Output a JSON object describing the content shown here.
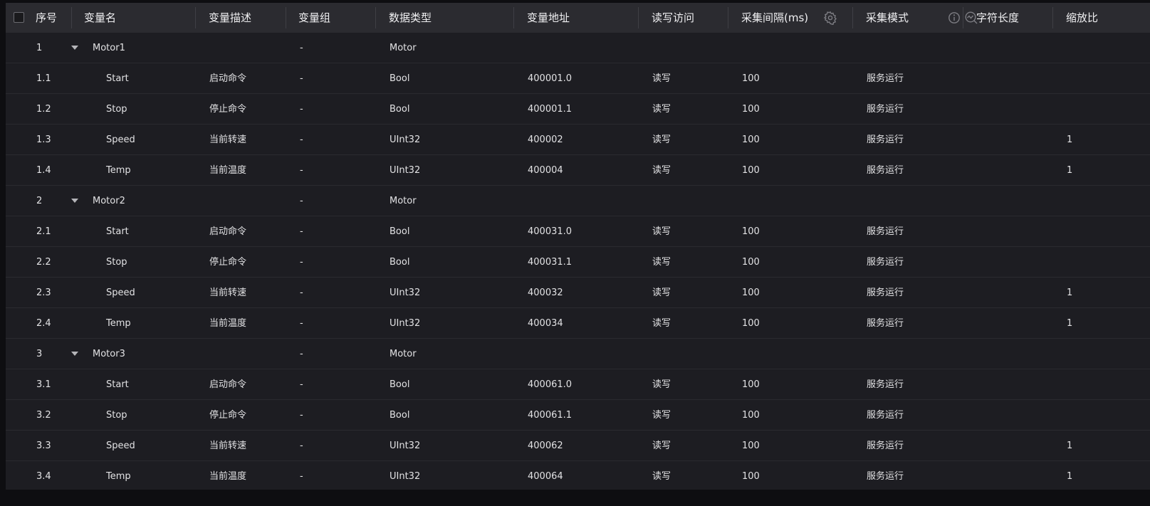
{
  "columns": [
    {
      "key": "index",
      "label": "序号"
    },
    {
      "key": "name",
      "label": "变量名"
    },
    {
      "key": "desc",
      "label": "变量描述"
    },
    {
      "key": "group",
      "label": "变量组"
    },
    {
      "key": "type",
      "label": "数据类型"
    },
    {
      "key": "addr",
      "label": "变量地址"
    },
    {
      "key": "access",
      "label": "读写访问"
    },
    {
      "key": "interval",
      "label": "采集间隔(ms)"
    },
    {
      "key": "mode",
      "label": "采集模式"
    },
    {
      "key": "strlen",
      "label": "字符长度"
    },
    {
      "key": "scale",
      "label": "缩放比"
    }
  ],
  "header_icons": {
    "interval_settings": "gear-icon",
    "mode_info": "info-icon",
    "mode_trend": "trend-search-icon"
  },
  "rows": [
    {
      "index": "1",
      "name": "Motor1",
      "desc": "",
      "group": "-",
      "type": "Motor",
      "addr": "",
      "access": "",
      "interval": "",
      "mode": "",
      "strlen": "",
      "scale": "",
      "parent": true
    },
    {
      "index": "1.1",
      "name": "Start",
      "desc": "启动命令",
      "group": "-",
      "type": "Bool",
      "addr": "400001.0",
      "access": "读写",
      "interval": "100",
      "mode": "服务运行",
      "strlen": "",
      "scale": ""
    },
    {
      "index": "1.2",
      "name": "Stop",
      "desc": "停止命令",
      "group": "-",
      "type": "Bool",
      "addr": "400001.1",
      "access": "读写",
      "interval": "100",
      "mode": "服务运行",
      "strlen": "",
      "scale": ""
    },
    {
      "index": "1.3",
      "name": "Speed",
      "desc": "当前转速",
      "group": "-",
      "type": "UInt32",
      "addr": "400002",
      "access": "读写",
      "interval": "100",
      "mode": "服务运行",
      "strlen": "",
      "scale": "1"
    },
    {
      "index": "1.4",
      "name": "Temp",
      "desc": "当前温度",
      "group": "-",
      "type": "UInt32",
      "addr": "400004",
      "access": "读写",
      "interval": "100",
      "mode": "服务运行",
      "strlen": "",
      "scale": "1"
    },
    {
      "index": "2",
      "name": "Motor2",
      "desc": "",
      "group": "-",
      "type": "Motor",
      "addr": "",
      "access": "",
      "interval": "",
      "mode": "",
      "strlen": "",
      "scale": "",
      "parent": true
    },
    {
      "index": "2.1",
      "name": "Start",
      "desc": "启动命令",
      "group": "-",
      "type": "Bool",
      "addr": "400031.0",
      "access": "读写",
      "interval": "100",
      "mode": "服务运行",
      "strlen": "",
      "scale": ""
    },
    {
      "index": "2.2",
      "name": "Stop",
      "desc": "停止命令",
      "group": "-",
      "type": "Bool",
      "addr": "400031.1",
      "access": "读写",
      "interval": "100",
      "mode": "服务运行",
      "strlen": "",
      "scale": ""
    },
    {
      "index": "2.3",
      "name": "Speed",
      "desc": "当前转速",
      "group": "-",
      "type": "UInt32",
      "addr": "400032",
      "access": "读写",
      "interval": "100",
      "mode": "服务运行",
      "strlen": "",
      "scale": "1"
    },
    {
      "index": "2.4",
      "name": "Temp",
      "desc": "当前温度",
      "group": "-",
      "type": "UInt32",
      "addr": "400034",
      "access": "读写",
      "interval": "100",
      "mode": "服务运行",
      "strlen": "",
      "scale": "1"
    },
    {
      "index": "3",
      "name": "Motor3",
      "desc": "",
      "group": "-",
      "type": "Motor",
      "addr": "",
      "access": "",
      "interval": "",
      "mode": "",
      "strlen": "",
      "scale": "",
      "parent": true
    },
    {
      "index": "3.1",
      "name": "Start",
      "desc": "启动命令",
      "group": "-",
      "type": "Bool",
      "addr": "400061.0",
      "access": "读写",
      "interval": "100",
      "mode": "服务运行",
      "strlen": "",
      "scale": ""
    },
    {
      "index": "3.2",
      "name": "Stop",
      "desc": "停止命令",
      "group": "-",
      "type": "Bool",
      "addr": "400061.1",
      "access": "读写",
      "interval": "100",
      "mode": "服务运行",
      "strlen": "",
      "scale": ""
    },
    {
      "index": "3.3",
      "name": "Speed",
      "desc": "当前转速",
      "group": "-",
      "type": "UInt32",
      "addr": "400062",
      "access": "读写",
      "interval": "100",
      "mode": "服务运行",
      "strlen": "",
      "scale": "1"
    },
    {
      "index": "3.4",
      "name": "Temp",
      "desc": "当前温度",
      "group": "-",
      "type": "UInt32",
      "addr": "400064",
      "access": "读写",
      "interval": "100",
      "mode": "服务运行",
      "strlen": "",
      "scale": "1"
    }
  ]
}
